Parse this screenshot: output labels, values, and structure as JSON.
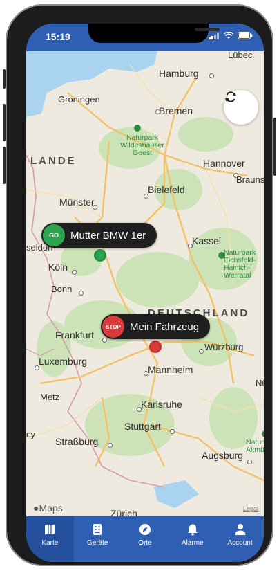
{
  "status_bar": {
    "time": "15:19"
  },
  "map": {
    "cities": [
      "Hamburg",
      "Groningen",
      "Bremen",
      "Hannover",
      "Braunschw",
      "Bielefeld",
      "Münster",
      "Kassel",
      "Köln",
      "Bonn",
      "Frankfurt",
      "Würzburg",
      "Luxemburg",
      "Mannheim",
      "Nü",
      "Metz",
      "Karlsruhe",
      "Stuttgart",
      "Straßburg",
      "Augsburg",
      "Zürich",
      "Lübec",
      "seldorf",
      "cy"
    ],
    "countries": [
      "LANDE",
      "DEUTSCHLAND"
    ],
    "parks": [
      "Naturpark\nWildeshauser\nGeest",
      "Naturpark\nEichsfeld-\nHainich-\nWerratal",
      "Naturpar\nAltmü"
    ],
    "provider": "Maps",
    "legal": "Legal"
  },
  "markers": [
    {
      "badge": "GO",
      "label": "Mutter BMW 1er",
      "color": "#2ea44f"
    },
    {
      "badge": "STOP",
      "label": "Mein Fahrzeug",
      "color": "#d93a3a"
    }
  ],
  "tabs": [
    {
      "label": "Karte",
      "icon": "map-icon"
    },
    {
      "label": "Geräte",
      "icon": "devices-icon"
    },
    {
      "label": "Orte",
      "icon": "compass-icon"
    },
    {
      "label": "Alarme",
      "icon": "bell-icon"
    },
    {
      "label": "Account",
      "icon": "person-icon"
    }
  ],
  "colors": {
    "primary": "#2f5fb3",
    "go": "#2ea44f",
    "stop": "#d93a3a"
  }
}
